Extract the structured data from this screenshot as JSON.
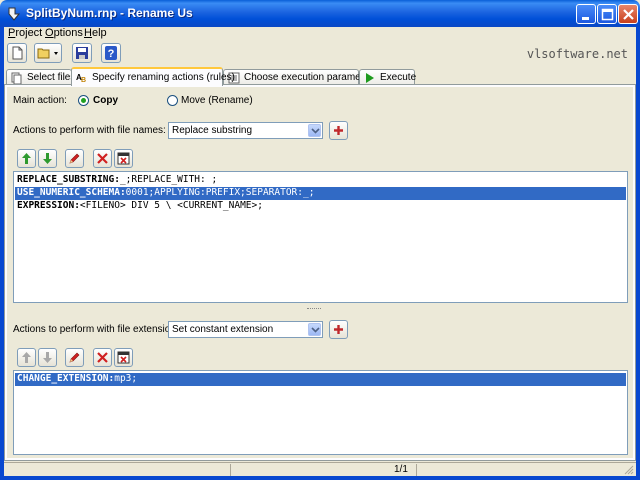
{
  "window": {
    "title": "SplitByNum.rnp - Rename Us"
  },
  "menu": {
    "items": [
      "Project",
      "Options",
      "Help"
    ]
  },
  "toolbar": {
    "brand": "vlsoftware.net",
    "icons": [
      "new-file-icon",
      "open-folder-icon",
      "save-icon",
      "help-icon"
    ]
  },
  "tabs": [
    {
      "label": "Select files",
      "active": false
    },
    {
      "label": "Specify renaming actions (rules)",
      "active": true
    },
    {
      "label": "Choose execution parameters",
      "active": false
    },
    {
      "label": "Execute",
      "active": false
    }
  ],
  "main_action": {
    "label": "Main action:",
    "options": [
      {
        "label": "Copy",
        "selected": true
      },
      {
        "label": "Move (Rename)",
        "selected": false
      }
    ]
  },
  "file_names": {
    "label": "Actions to perform with file names:",
    "combo_value": "Replace substring",
    "rows": [
      {
        "keyword": "REPLACE_SUBSTRING:",
        "text": "_;REPLACE_WITH: ;",
        "selected": false
      },
      {
        "keyword": "USE_NUMERIC_SCHEMA:",
        "text": "0001;APPLYING:PREFIX;SEPARATOR:_;",
        "selected": true
      },
      {
        "keyword": "EXPRESSION:",
        "text": "<FILENO> DIV 5 \\ <CURRENT_NAME>;",
        "selected": false
      }
    ]
  },
  "file_extensions": {
    "label": "Actions to perform with file extensions:",
    "combo_value": "Set constant extension",
    "rows": [
      {
        "keyword": "CHANGE_EXTENSION:",
        "text": "mp3;",
        "selected": true
      }
    ]
  },
  "status": {
    "page": "1/1"
  },
  "colors": {
    "selection": "#316ac5",
    "titlebar": "#0a5fd8",
    "add_red": "#c0282c",
    "arrow_green": "#2e9a2e"
  }
}
